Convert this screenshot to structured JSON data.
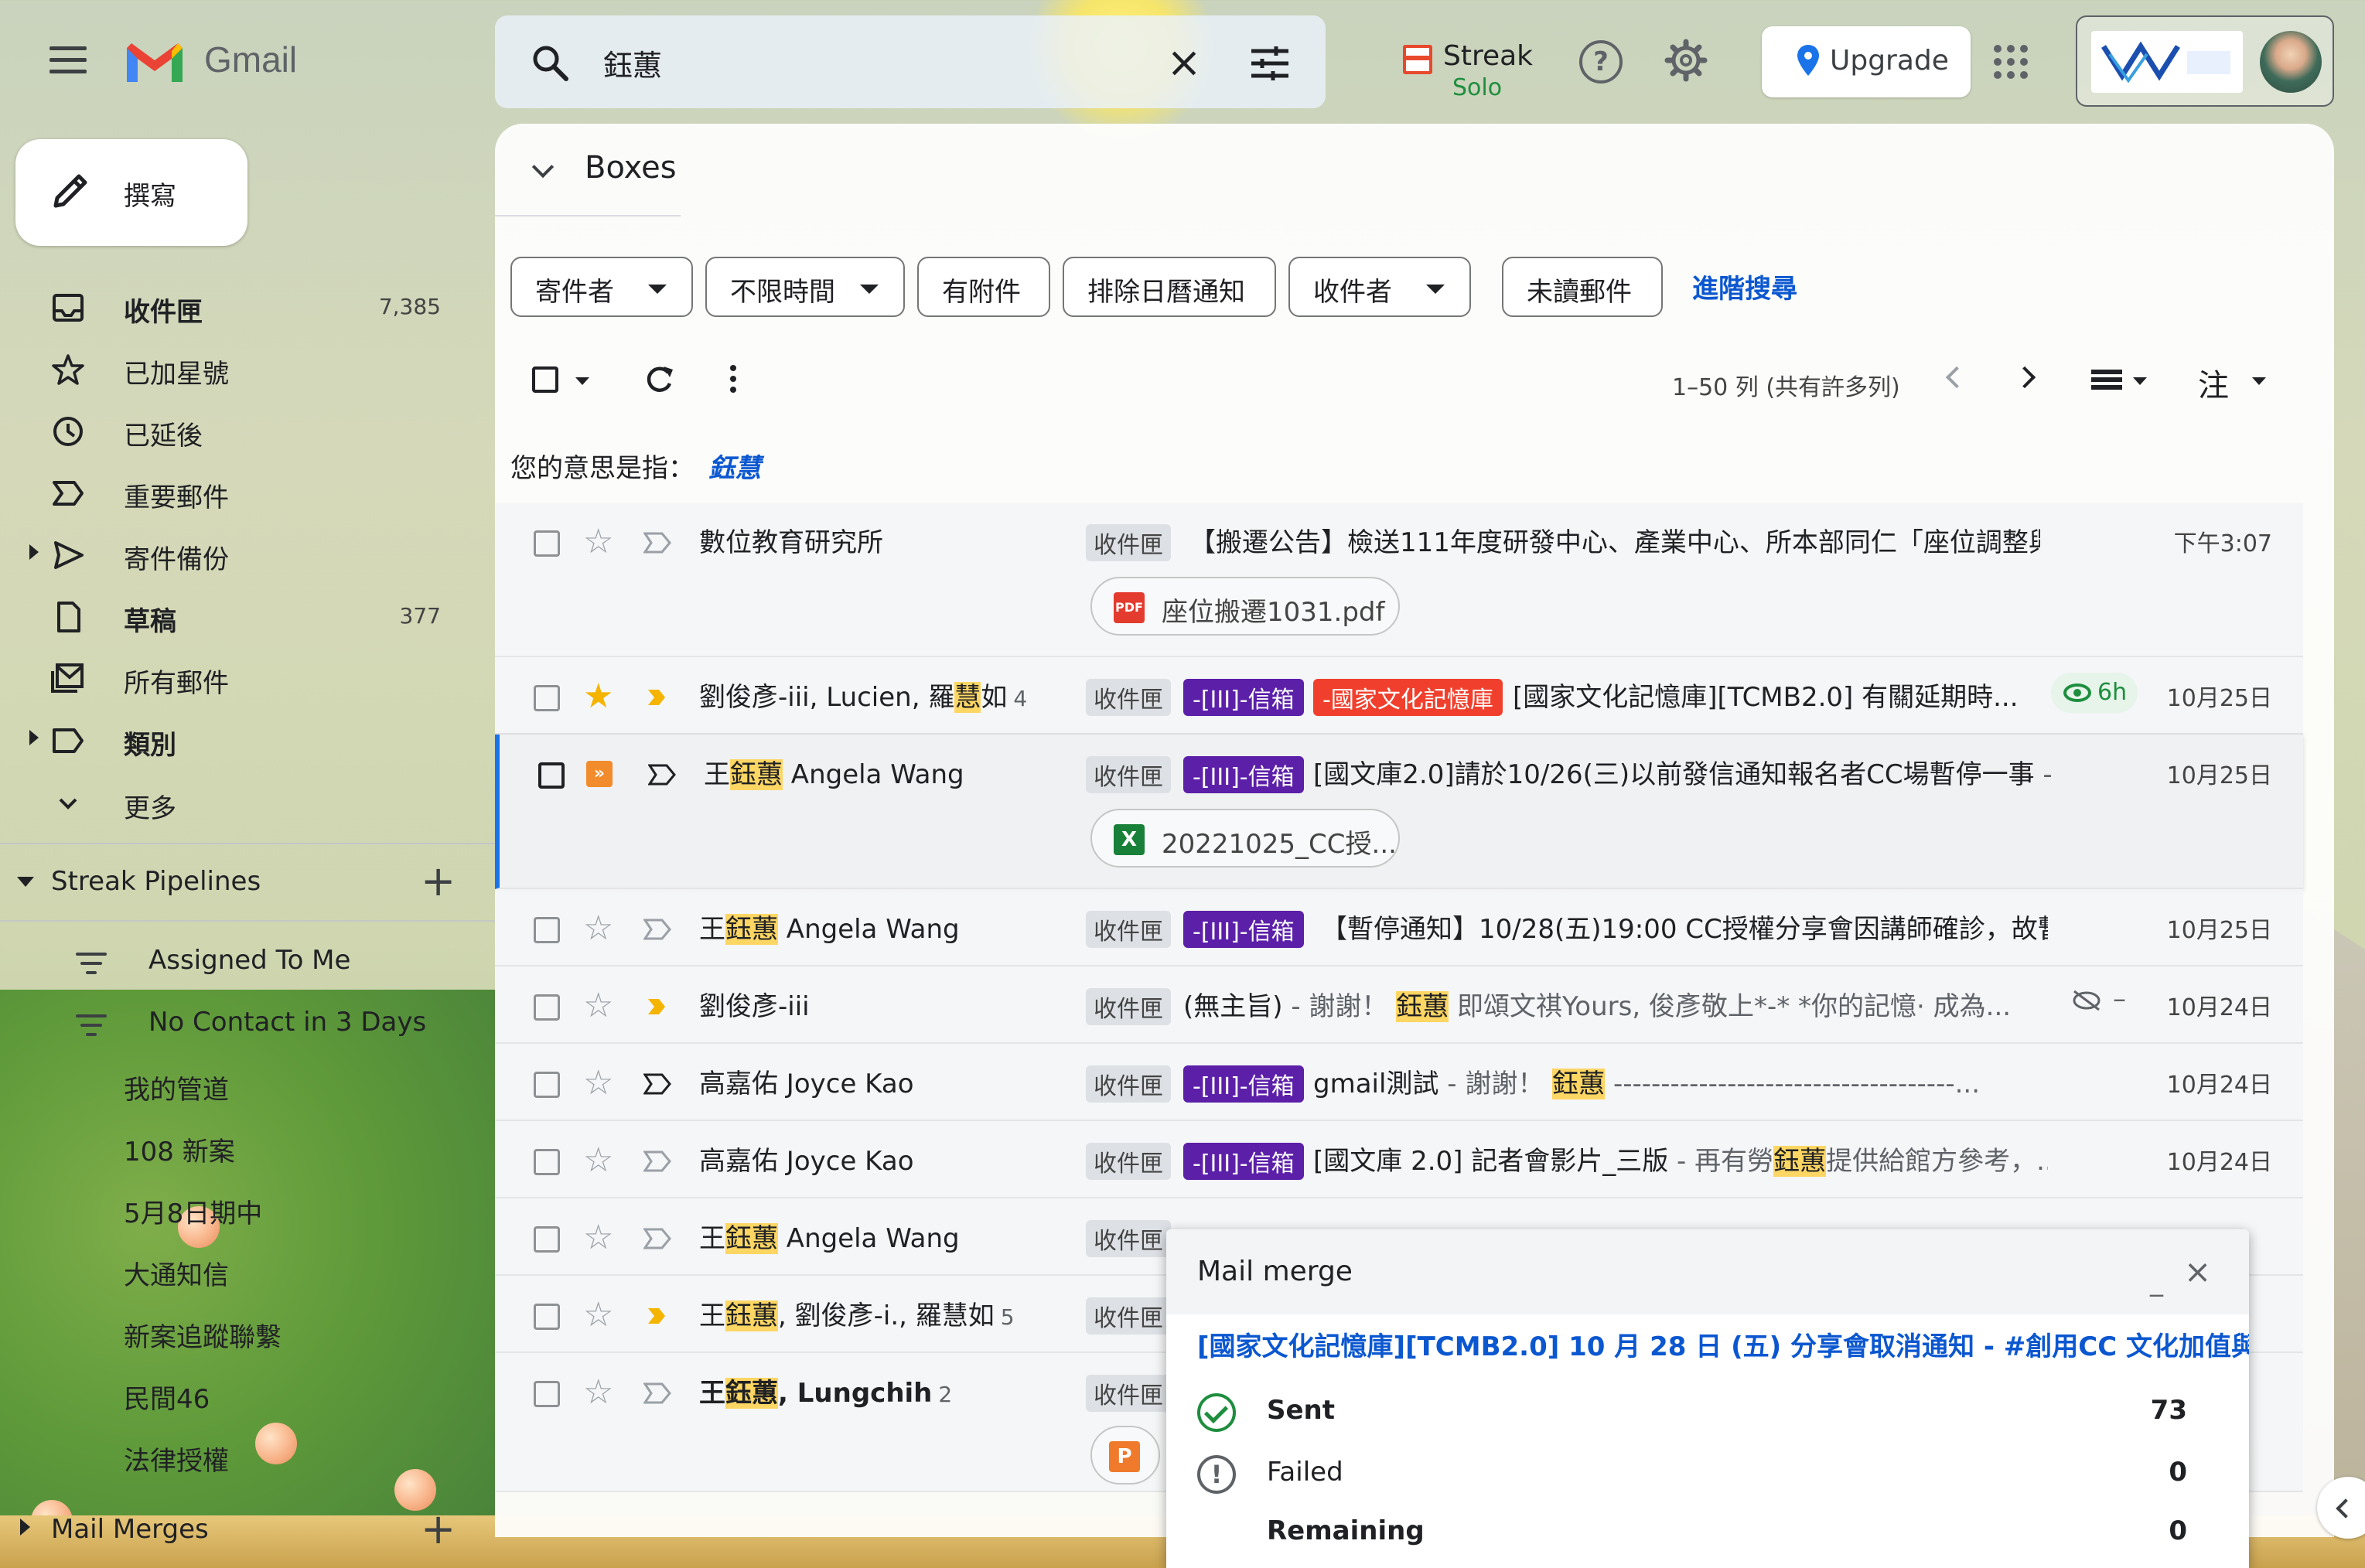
{
  "app": {
    "name": "Gmail"
  },
  "search": {
    "value": "鈺蕙"
  },
  "header": {
    "streak_label": "Streak",
    "streak_plan": "Solo",
    "upgrade_label": "Upgrade"
  },
  "compose": {
    "label": "撰寫"
  },
  "sidebar": {
    "items": [
      {
        "label": "收件匣",
        "count": "7,385",
        "icon": "inbox-icon",
        "bold": true
      },
      {
        "label": "已加星號",
        "count": "",
        "icon": "star-icon"
      },
      {
        "label": "已延後",
        "count": "",
        "icon": "clock-icon"
      },
      {
        "label": "重要郵件",
        "count": "",
        "icon": "important-icon"
      },
      {
        "label": "寄件備份",
        "count": "",
        "icon": "send-icon"
      },
      {
        "label": "草稿",
        "count": "377",
        "icon": "draft-icon",
        "bold": true
      },
      {
        "label": "所有郵件",
        "count": "",
        "icon": "all-mail-icon"
      },
      {
        "label": "類別",
        "count": "",
        "icon": "label-icon",
        "bold": true
      },
      {
        "label": "更多",
        "count": "",
        "icon": "chevron-down-icon"
      }
    ],
    "streak_section": "Streak Pipelines",
    "streak_filters": [
      "Assigned To Me",
      "No Contact in 3 Days"
    ],
    "pipelines": [
      "我的管道",
      "108 新案",
      "5月8日期中",
      "大通知信",
      "新案追蹤聯繫",
      "民間46",
      "法律授權"
    ],
    "mail_merges_section": "Mail Merges"
  },
  "main": {
    "section_title": "Boxes",
    "chips": [
      "寄件者",
      "不限時間",
      "有附件",
      "排除日曆通知",
      "收件者",
      "未讀郵件"
    ],
    "advanced_search": "進階搜尋",
    "pager": "1–50 列 (共有許多列)",
    "note_button": "注",
    "did_you_mean_prefix": "您的意思是指：",
    "did_you_mean_term": "鈺慧"
  },
  "emails": [
    {
      "sender": "數位教育研究所",
      "label": "收件匣",
      "subject": "【搬遷公告】檢送111年度研發中心、產業中心、所本部同仁「座位調整與...",
      "date": "下午3:07",
      "attachment": "座位搬遷1031.pdf"
    },
    {
      "sender_pre": "劉俊彥-iii, Lucien, 羅",
      "sender_hl": "慧",
      "sender_post": "如",
      "count": "4",
      "label": "收件匣",
      "tag": "-[III]-信箱",
      "tag2": "-國家文化記憶庫",
      "subject": "[國家文化記憶庫][TCMB2.0] 有關延期時...",
      "eye": "6h",
      "date": "10月25日"
    },
    {
      "sender_pre": "王",
      "sender_hl": "鈺蕙",
      "sender_post": " Angela Wang",
      "label": "收件匣",
      "tag": "-[III]-信箱",
      "subject": "[國文庫2.0]請於10/26(三)以前發信通知報名者CC場暫停一事",
      "snippet": " - 謝",
      "date": "10月25日",
      "attachment": "20221025_CC授..."
    },
    {
      "sender_pre": "王",
      "sender_hl": "鈺蕙",
      "sender_post": " Angela Wang",
      "label": "收件匣",
      "tag": "-[III]-信箱",
      "subject": "【暫停通知】10/28(五)19:00 CC授權分享會因講師確診，故暫...",
      "date": "10月25日"
    },
    {
      "sender": "劉俊彥-iii",
      "label": "收件匣",
      "subject_pre": "(無主旨)",
      "snippet_pre": " - 謝謝！ ",
      "subject_hl": "鈺蕙",
      "snippet_post": " 即頌文祺Yours, 俊彥敬上*-* *你的記憶· 成為...",
      "date": "10月24日"
    },
    {
      "sender": "高嘉佑 Joyce Kao",
      "label": "收件匣",
      "tag": "-[III]-信箱",
      "subject_pre": "gmail測試",
      "snippet_pre": " - 謝謝！ ",
      "subject_hl": "鈺蕙",
      "snippet_post": " ------------------------------------...",
      "date": "10月24日"
    },
    {
      "sender": "高嘉佑 Joyce Kao",
      "label": "收件匣",
      "tag": "-[III]-信箱",
      "subject_pre": "[國文庫 2.0] 記者會影片_三版",
      "snippet_pre": " - 再有勞",
      "subject_hl": "鈺蕙",
      "snippet_post": "提供給館方參考，...",
      "date": "10月24日"
    },
    {
      "sender_pre": "王",
      "sender_hl": "鈺蕙",
      "sender_post": " Angela Wang",
      "label": "收件匣"
    },
    {
      "sender_pre": "王",
      "sender_hl": "鈺蕙",
      "sender_post": ", 劉俊彥-i., 羅慧如",
      "count": "5",
      "label": "收件匣"
    },
    {
      "sender_pre": "王",
      "sender_hl": "鈺蕙",
      "sender_post": ", Lungchih",
      "count": "2",
      "label": "收件匣"
    }
  ],
  "mail_merge": {
    "title": "Mail merge",
    "subject": "[國家文化記憶庫][TCMB2.0] 10 月 28 日 (五) 分享會取消通知 - #創用CC 文化加值與國際流通",
    "sent_label": "Sent",
    "sent": "73",
    "failed_label": "Failed",
    "failed": "0",
    "remaining_label": "Remaining",
    "remaining": "0"
  },
  "colors": {
    "accent": "#0b57d0",
    "highlight": "#fdd663",
    "tag_purple": "#5b1fa8",
    "tag_red": "#f0402d",
    "star": "#f4b400",
    "ok": "#1e8e3e"
  }
}
